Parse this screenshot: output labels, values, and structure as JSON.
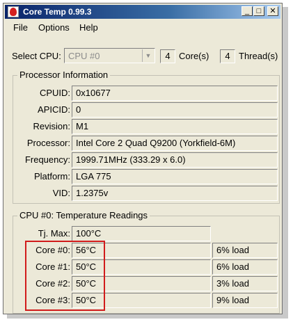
{
  "window": {
    "title": "Core Temp 0.99.3"
  },
  "titlebar": {
    "minimize_glyph": "_",
    "maximize_glyph": "□",
    "close_glyph": "✕"
  },
  "menu": {
    "file": "File",
    "options": "Options",
    "help": "Help"
  },
  "cpu_selector": {
    "label": "Select CPU:",
    "selected": "CPU #0",
    "dropdown_glyph": "▼",
    "cores_count": "4",
    "cores_label": "Core(s)",
    "threads_count": "4",
    "threads_label": "Thread(s)"
  },
  "processor_info": {
    "group_title": "Processor Information",
    "rows": [
      {
        "label": "CPUID:",
        "value": "0x10677"
      },
      {
        "label": "APICID:",
        "value": "0"
      },
      {
        "label": "Revision:",
        "value": "M1"
      },
      {
        "label": "Processor:",
        "value": "Intel Core 2 Quad Q9200 (Yorkfield-6M)"
      },
      {
        "label": "Frequency:",
        "value": "1999.71MHz (333.29 x 6.0)"
      },
      {
        "label": "Platform:",
        "value": "LGA 775"
      },
      {
        "label": "VID:",
        "value": "1.2375v"
      }
    ]
  },
  "temperature": {
    "group_title": "CPU #0: Temperature Readings",
    "tjmax_label": "Tj. Max:",
    "tjmax_value": "100°C",
    "cores": [
      {
        "label": "Core #0:",
        "temp": "56°C",
        "load": "6% load"
      },
      {
        "label": "Core #1:",
        "temp": "50°C",
        "load": "6% load"
      },
      {
        "label": "Core #2:",
        "temp": "50°C",
        "load": "3% load"
      },
      {
        "label": "Core #3:",
        "temp": "50°C",
        "load": "9% load"
      }
    ]
  },
  "colors": {
    "titlebar_start": "#0a246a",
    "titlebar_end": "#a6caf0",
    "window_bg": "#ece9d8",
    "highlight": "#d11b1b"
  }
}
